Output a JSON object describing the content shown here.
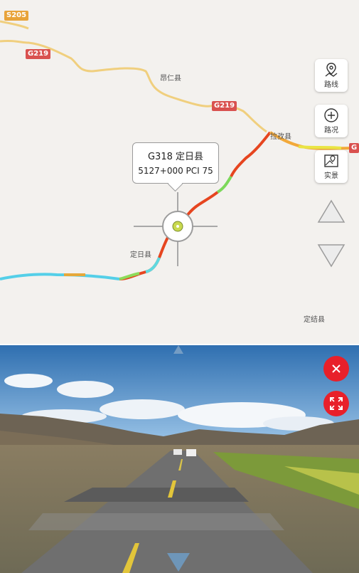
{
  "map": {
    "shields": {
      "s205": "S205",
      "g219_left": "G219",
      "g219_mid": "G219",
      "g_right": "G"
    },
    "places": {
      "angren": "昂仁县",
      "lazi": "拉孜县",
      "dingri": "定日县",
      "dingjie": "定结县"
    },
    "controls": {
      "route": "路线",
      "traffic": "路况",
      "live": "实景"
    },
    "tooltip": {
      "road_line": "G318 定日县",
      "stake_line": "5127+000 PCI 75"
    }
  },
  "photo": {
    "close_icon": "close-icon",
    "fullscreen_icon": "fullscreen-icon"
  }
}
